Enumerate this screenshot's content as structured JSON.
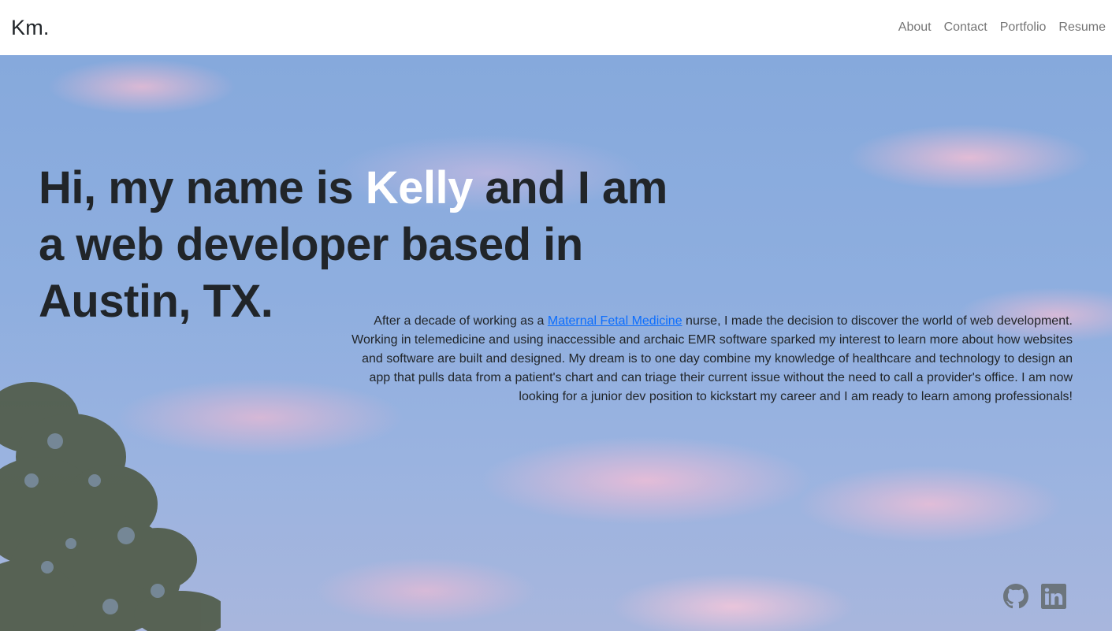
{
  "nav": {
    "brand": "Km.",
    "links": [
      "About",
      "Contact",
      "Portfolio",
      "Resume"
    ]
  },
  "hero": {
    "headline_before": "Hi, my name is ",
    "headline_name": "Kelly",
    "headline_after": " and I am a web developer based in Austin, TX.",
    "bio_before": "After a decade of working as a ",
    "bio_link": "Maternal Fetal Medicine",
    "bio_after": " nurse, I made the decision to discover the world of web development. Working in telemedicine and using inaccessible and archaic EMR software sparked my interest to learn more about how websites and software are built and designed. My dream is to one day combine my knowledge of healthcare and technology to design an app that pulls data from a patient's chart and can triage their current issue without the need to call a provider's office. I am now looking for a junior dev position to kickstart my career and I am ready to learn among professionals!"
  },
  "socials": [
    {
      "icon": "github-icon"
    },
    {
      "icon": "linkedin-icon"
    }
  ],
  "colors": {
    "name_highlight": "#ffffff",
    "link": "#0d6efd",
    "text": "#212529",
    "icon": "#6c757d"
  }
}
